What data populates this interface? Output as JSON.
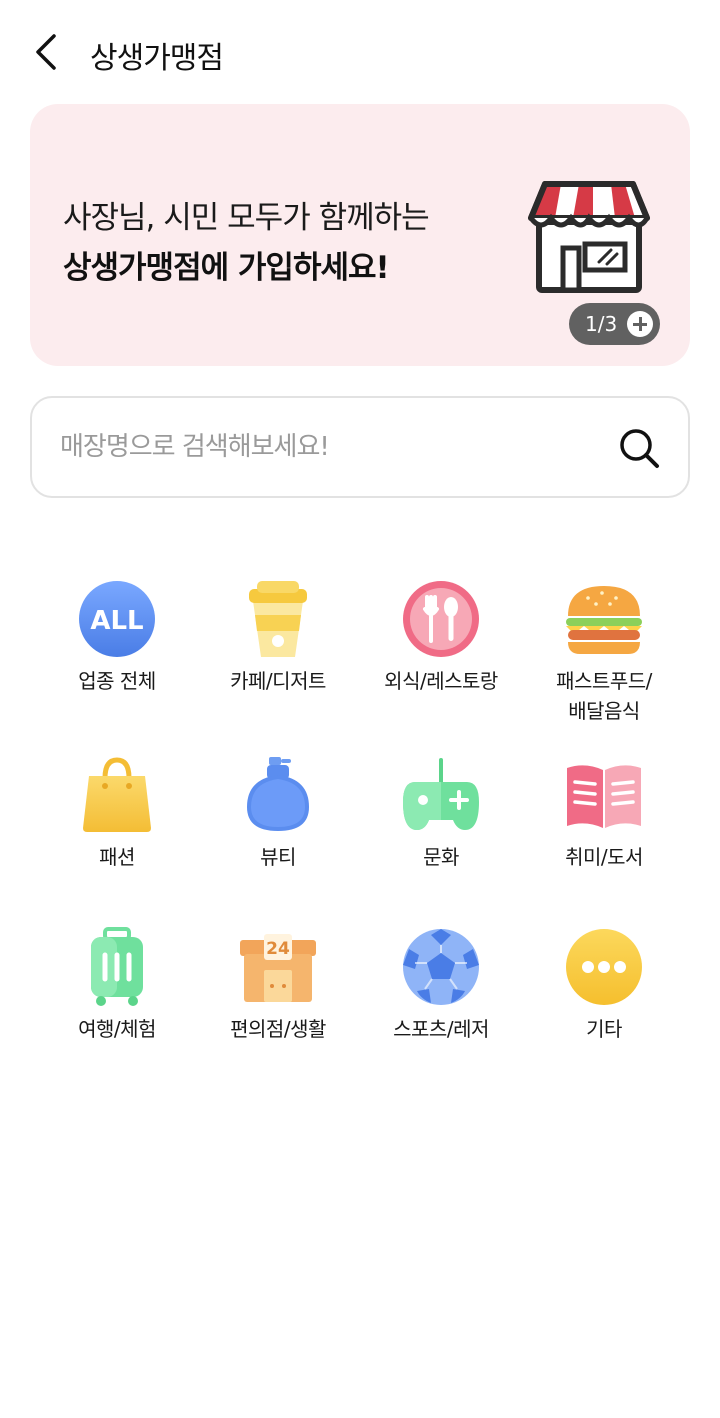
{
  "header": {
    "title": "상생가맹점"
  },
  "banner": {
    "line1": "사장님, 시민 모두가 함께하는",
    "line2": "상생가맹점에 가입하세요!",
    "pager": "1/3"
  },
  "search": {
    "placeholder": "매장명으로 검색해보세요!",
    "value": ""
  },
  "categories": {
    "all": "업종 전체",
    "all_badge": "ALL",
    "cafe": "카페/디저트",
    "restaurant": "외식/레스토랑",
    "fastfood_1": "패스트푸드/",
    "fastfood_2": "배달음식",
    "fashion": "패션",
    "beauty": "뷰티",
    "culture": "문화",
    "hobby": "취미/도서",
    "travel": "여행/체험",
    "convenience": "편의점/생활",
    "convenience_badge": "24",
    "sports": "스포츠/레저",
    "etc": "기타"
  },
  "colors": {
    "banner_bg": "#fcecee",
    "pager_bg": "#616161",
    "all_blue": "#5b8def",
    "pink": "#f06b86",
    "yellow": "#f9cd45",
    "green": "#6fe09d",
    "orange": "#f2a55a"
  }
}
